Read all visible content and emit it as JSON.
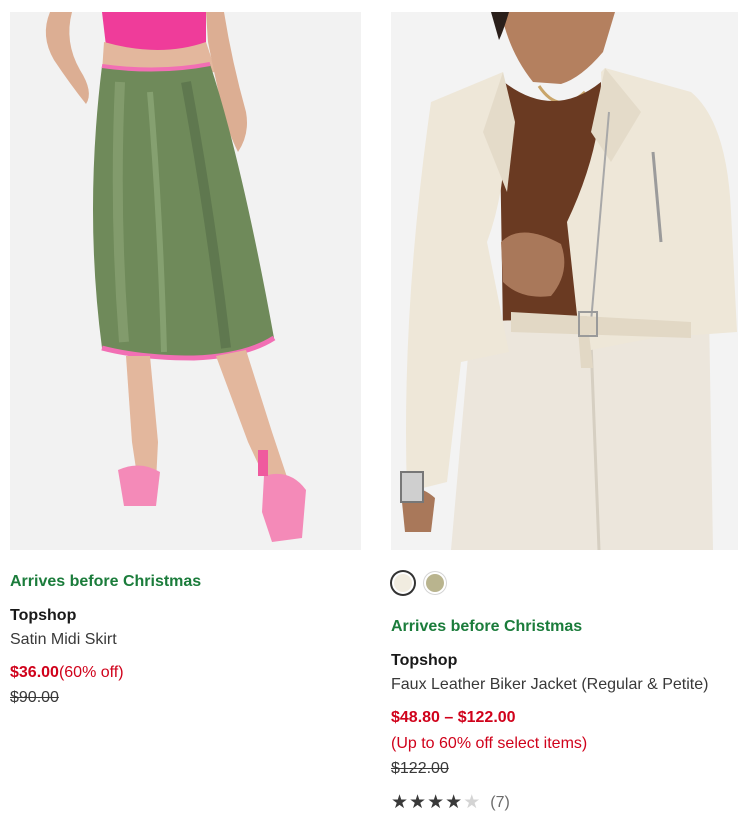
{
  "products": [
    {
      "image_alt": "Satin Midi Skirt",
      "arrival_note": "Arrives before Christmas",
      "brand": "Topshop",
      "name": "Satin Midi Skirt",
      "sale_price": "$36.00",
      "discount": "(60% off)",
      "original_price": "$90.00",
      "colors": {
        "skirt": "#6f8a5a",
        "trim": "#f26fb4",
        "top": "#f0439c",
        "shoe": "#f48ab8"
      }
    },
    {
      "image_alt": "Faux Leather Biker Jacket (Regular & Petite)",
      "swatches": [
        {
          "color": "#f1ece0",
          "selected": true
        },
        {
          "color": "#b9b48e",
          "selected": false
        }
      ],
      "arrival_note": "Arrives before Christmas",
      "brand": "Topshop",
      "name": "Faux Leather Biker Jacket (Regular & Petite)",
      "sale_price_range": "$48.80 – $122.00",
      "discount_note": "(Up to 60% off select items)",
      "original_price": "$122.00",
      "rating": {
        "stars": 4,
        "max": 5,
        "count": "(7)"
      },
      "colors": {
        "jacket": "#eee7d8",
        "shirt": "#6a3a22",
        "pants": "#ece6dc"
      }
    }
  ],
  "theme": {
    "arrival_green": "#1b7c3b",
    "sale_red": "#d0021b"
  }
}
